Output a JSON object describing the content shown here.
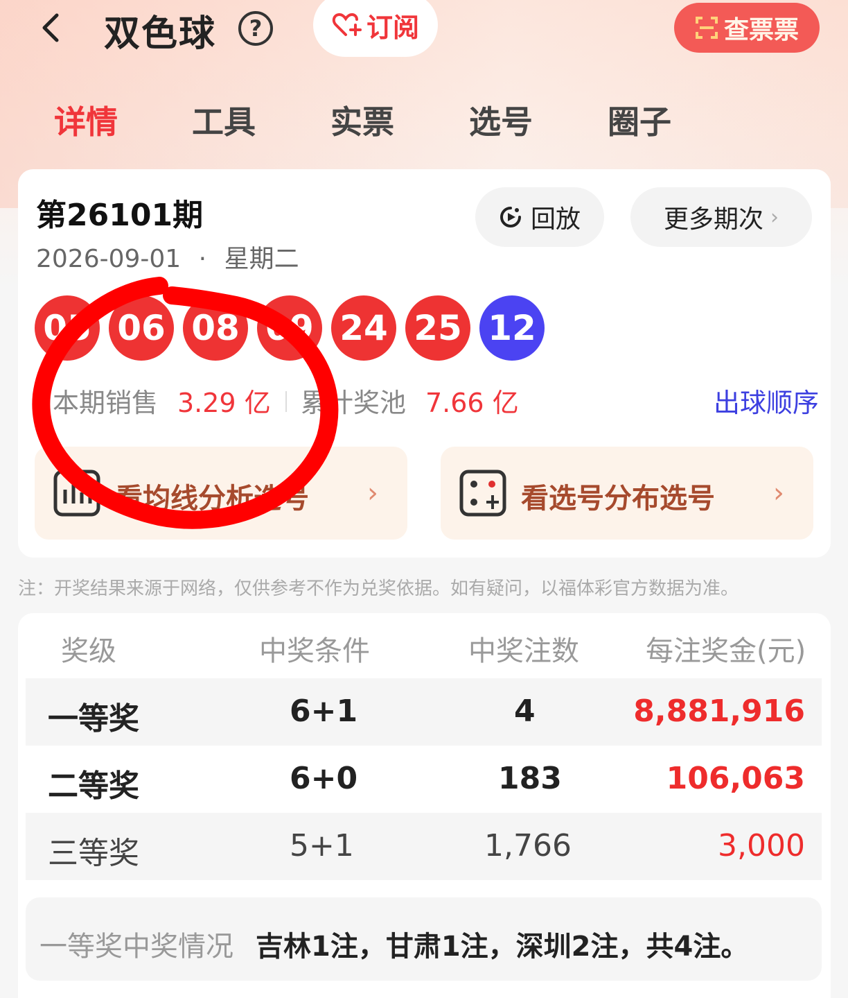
{
  "header": {
    "title": "双色球",
    "help": "?",
    "subscribe_label": "订阅",
    "ticket_label": "查票票"
  },
  "tabs": [
    {
      "label": "详情",
      "active": true
    },
    {
      "label": "工具"
    },
    {
      "label": "实票"
    },
    {
      "label": "选号"
    },
    {
      "label": "圈子"
    }
  ],
  "draw": {
    "issue": "第26101期",
    "date": "2026-09-01",
    "date_sep": "·",
    "weekday": "星期二",
    "replay_label": "回放",
    "more_label": "更多期次",
    "red_balls": [
      "05",
      "06",
      "08",
      "09",
      "24",
      "25"
    ],
    "blue_ball": "12",
    "sales_label": "本期销售",
    "sales_value": "3.29 亿",
    "pool_label": "累计奖池",
    "pool_value": "7.66 亿",
    "order_link": "出球顺序",
    "tool_left": "看均线分析选号",
    "tool_right": "看选号分布选号"
  },
  "note": "注：开奖结果来源于网络，仅供参考不作为兑奖依据。如有疑问，以福体彩官方数据为准。",
  "prizes": {
    "headers": [
      "奖级",
      "中奖条件",
      "中奖注数",
      "每注奖金(元)"
    ],
    "rows": [
      {
        "level": "一等奖",
        "condition": "6+1",
        "count": "4",
        "amount": "8,881,916"
      },
      {
        "level": "二等奖",
        "condition": "6+0",
        "count": "183",
        "amount": "106,063"
      },
      {
        "level": "三等奖",
        "condition": "5+1",
        "count": "1,766",
        "amount": "3,000"
      }
    ],
    "first_prize_label": "一等奖中奖情况",
    "first_prize_detail": "吉林1注，甘肃1注，深圳2注，共4注。"
  },
  "colors": {
    "accent_red": "#f0353a",
    "blue_ball": "#4b43f2",
    "link_blue": "#3c3fe0",
    "annotation_red": "#ff0000"
  }
}
